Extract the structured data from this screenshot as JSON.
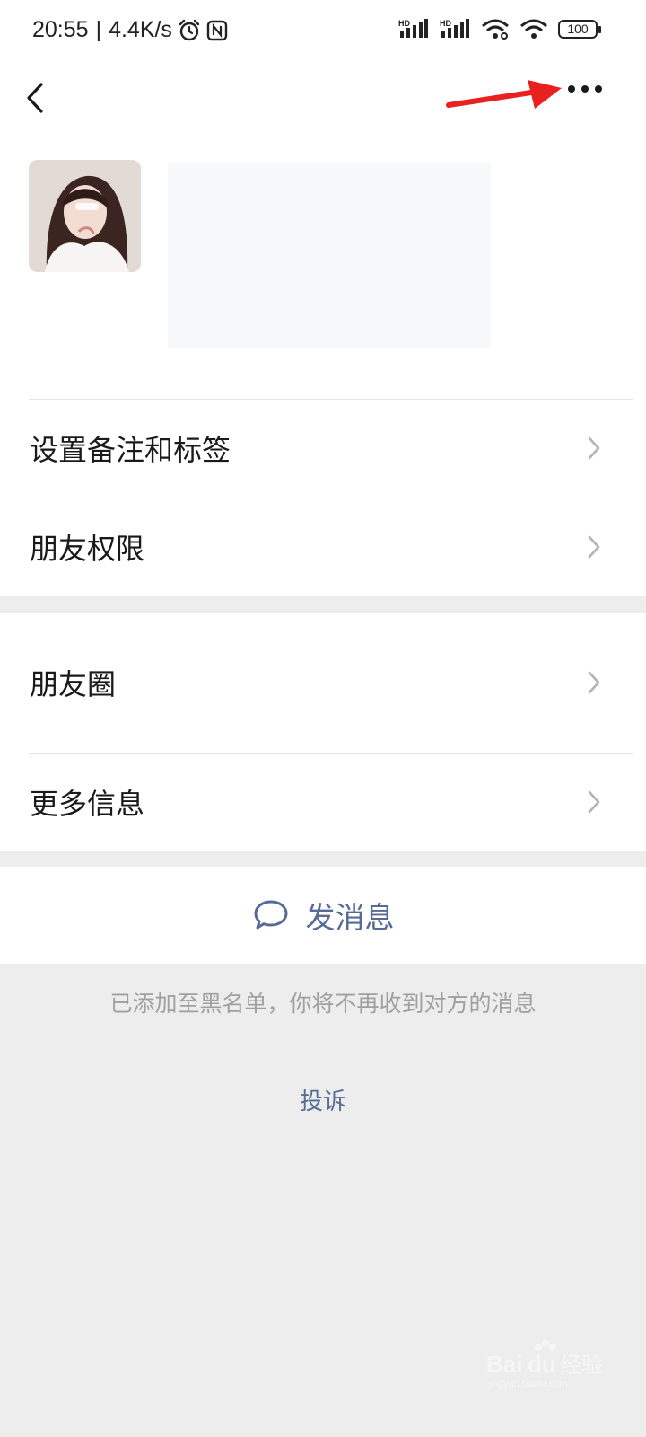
{
  "status_bar": {
    "time": "20:55",
    "speed": "4.4K/s",
    "battery": "100",
    "network_1": "HD",
    "network_2": "HD"
  },
  "nav": {
    "back_icon": "chevron-left-icon",
    "more_icon": "more-dots-icon",
    "annotation_color": "#e8201e"
  },
  "menu": {
    "group1": [
      {
        "label": "设置备注和标签"
      },
      {
        "label": "朋友权限"
      }
    ],
    "group2": [
      {
        "label": "朋友圈"
      },
      {
        "label": "更多信息"
      }
    ]
  },
  "actions": {
    "send_message": "发消息",
    "send_icon": "chat-bubble-icon"
  },
  "notice": "已添加至黑名单，你将不再收到对方的消息",
  "complain": "投诉",
  "watermark": {
    "text": "Baidu经验",
    "sub": "jingyan.baidu.com"
  },
  "colors": {
    "link": "#576b95",
    "background": "#ededed"
  }
}
